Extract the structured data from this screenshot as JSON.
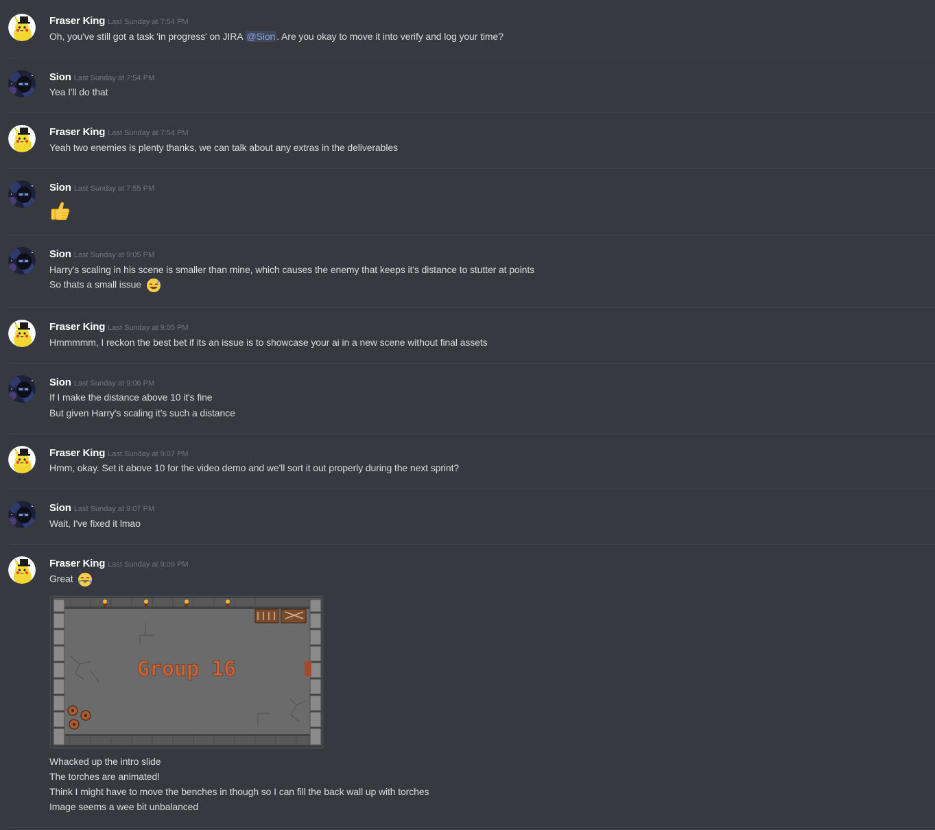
{
  "messages": [
    {
      "author": "Fraser King",
      "time": "Last Sunday at 7:54 PM",
      "text_before": "Oh, you've still got a task 'in progress' on JIRA ",
      "mention": "@Sion",
      "text_after": ". Are you okay to move it into verify and log your time?"
    },
    {
      "author": "Sion",
      "time": "Last Sunday at 7:54 PM",
      "lines": [
        "Yea I'll do that"
      ]
    },
    {
      "author": "Fraser King",
      "time": "Last Sunday at 7:54 PM",
      "lines": [
        "Yeah two enemies is plenty thanks, we can talk about any extras in the deliverables"
      ]
    },
    {
      "author": "Sion",
      "time": "Last Sunday at 7:55 PM",
      "emoji": "thumbs-up-icon"
    },
    {
      "author": "Sion",
      "time": "Last Sunday at 9:05 PM",
      "lines": [
        "Harry's scaling in his scene is smaller than mine, which causes the enemy that keeps it's distance to stutter at points",
        "So thats a small issue"
      ],
      "emoji": "sweat-smile-icon"
    },
    {
      "author": "Fraser King",
      "time": "Last Sunday at 9:05 PM",
      "lines": [
        "Hmmmmm, I reckon the best bet if its an issue is to showcase your ai in a new scene without final assets"
      ]
    },
    {
      "author": "Sion",
      "time": "Last Sunday at 9:06 PM",
      "lines": [
        "If I make the distance above 10 it's fine",
        "But given Harry's scaling it's such a distance"
      ]
    },
    {
      "author": "Fraser King",
      "time": "Last Sunday at 9:07 PM",
      "lines": [
        "Hmm, okay. Set it above 10 for the video demo and we'll sort it out properly during the next sprint?"
      ]
    },
    {
      "author": "Sion",
      "time": "Last Sunday at 9:07 PM",
      "lines": [
        "Wait, I've fixed it lmao"
      ]
    },
    {
      "author": "Fraser King",
      "time": "Last Sunday at 9:09 PM",
      "lines": [
        "Great"
      ],
      "emoji": "joy-icon",
      "attachment_title": "Group 16",
      "after_lines": [
        "Whacked up the intro slide",
        "The torches are animated!",
        "Think I might have to move the benches in though so I can fill the back wall up with torches",
        "Image seems a wee bit unbalanced"
      ]
    }
  ],
  "colors": {
    "background": "#36393f",
    "divider": "#42454a",
    "username": "#ffffff",
    "timestamp": "#72767d",
    "text": "#dcddde",
    "mention": "#8ea1e1",
    "attachment_title": "#c6683f"
  }
}
